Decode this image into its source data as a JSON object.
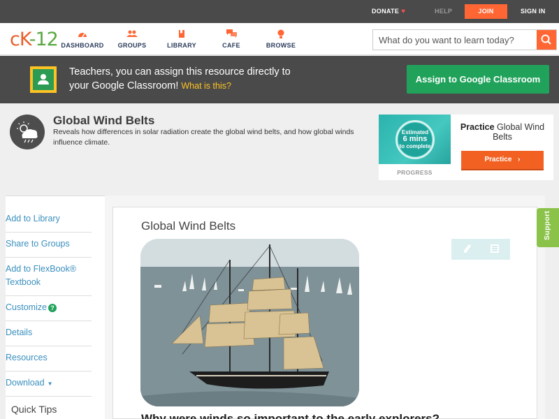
{
  "topbar": {
    "donate": "DONATE",
    "help": "HELP",
    "join": "JOIN",
    "signin": "SIGN IN"
  },
  "logo": {
    "c": "cK",
    "k": "-12"
  },
  "nav": [
    {
      "label": "DASHBOARD",
      "icon": "dashboard-icon"
    },
    {
      "label": "GROUPS",
      "icon": "groups-icon"
    },
    {
      "label": "LIBRARY",
      "icon": "library-icon"
    },
    {
      "label": "CAFE",
      "icon": "cafe-icon"
    },
    {
      "label": "BROWSE",
      "icon": "browse-icon"
    }
  ],
  "search": {
    "placeholder": "What do you want to learn today?"
  },
  "banner": {
    "line1": "Teachers, you can assign this resource directly to",
    "line2": "your Google Classroom!",
    "what": "What is this?",
    "button": "Assign to Google Classroom"
  },
  "concept": {
    "title": "Global Wind Belts",
    "description": "Reveals how differences in solar radiation create the global wind belts, and how global winds influence climate."
  },
  "practice": {
    "estimated": "Estimated",
    "mins": "6 mins",
    "to_complete": "to complete",
    "progress_label": "PROGRESS",
    "heading_bold": "Practice",
    "heading_rest": "Global Wind Belts",
    "button": "Practice"
  },
  "sidebar": {
    "items": [
      {
        "label": "Add to Library"
      },
      {
        "label": "Share to Groups"
      },
      {
        "label": "Add to FlexBook® Textbook"
      },
      {
        "label": "Customize"
      },
      {
        "label": "Details"
      },
      {
        "label": "Resources"
      },
      {
        "label": "Download"
      }
    ],
    "quick_tips": "Quick Tips"
  },
  "article": {
    "title": "Global Wind Belts",
    "question": "Why were winds so important to the early explorers?"
  },
  "support": "Support",
  "colors": {
    "accent": "#ff6633",
    "green": "#21a25b",
    "link": "#3a8fbd",
    "dark": "#4a4a4a"
  }
}
